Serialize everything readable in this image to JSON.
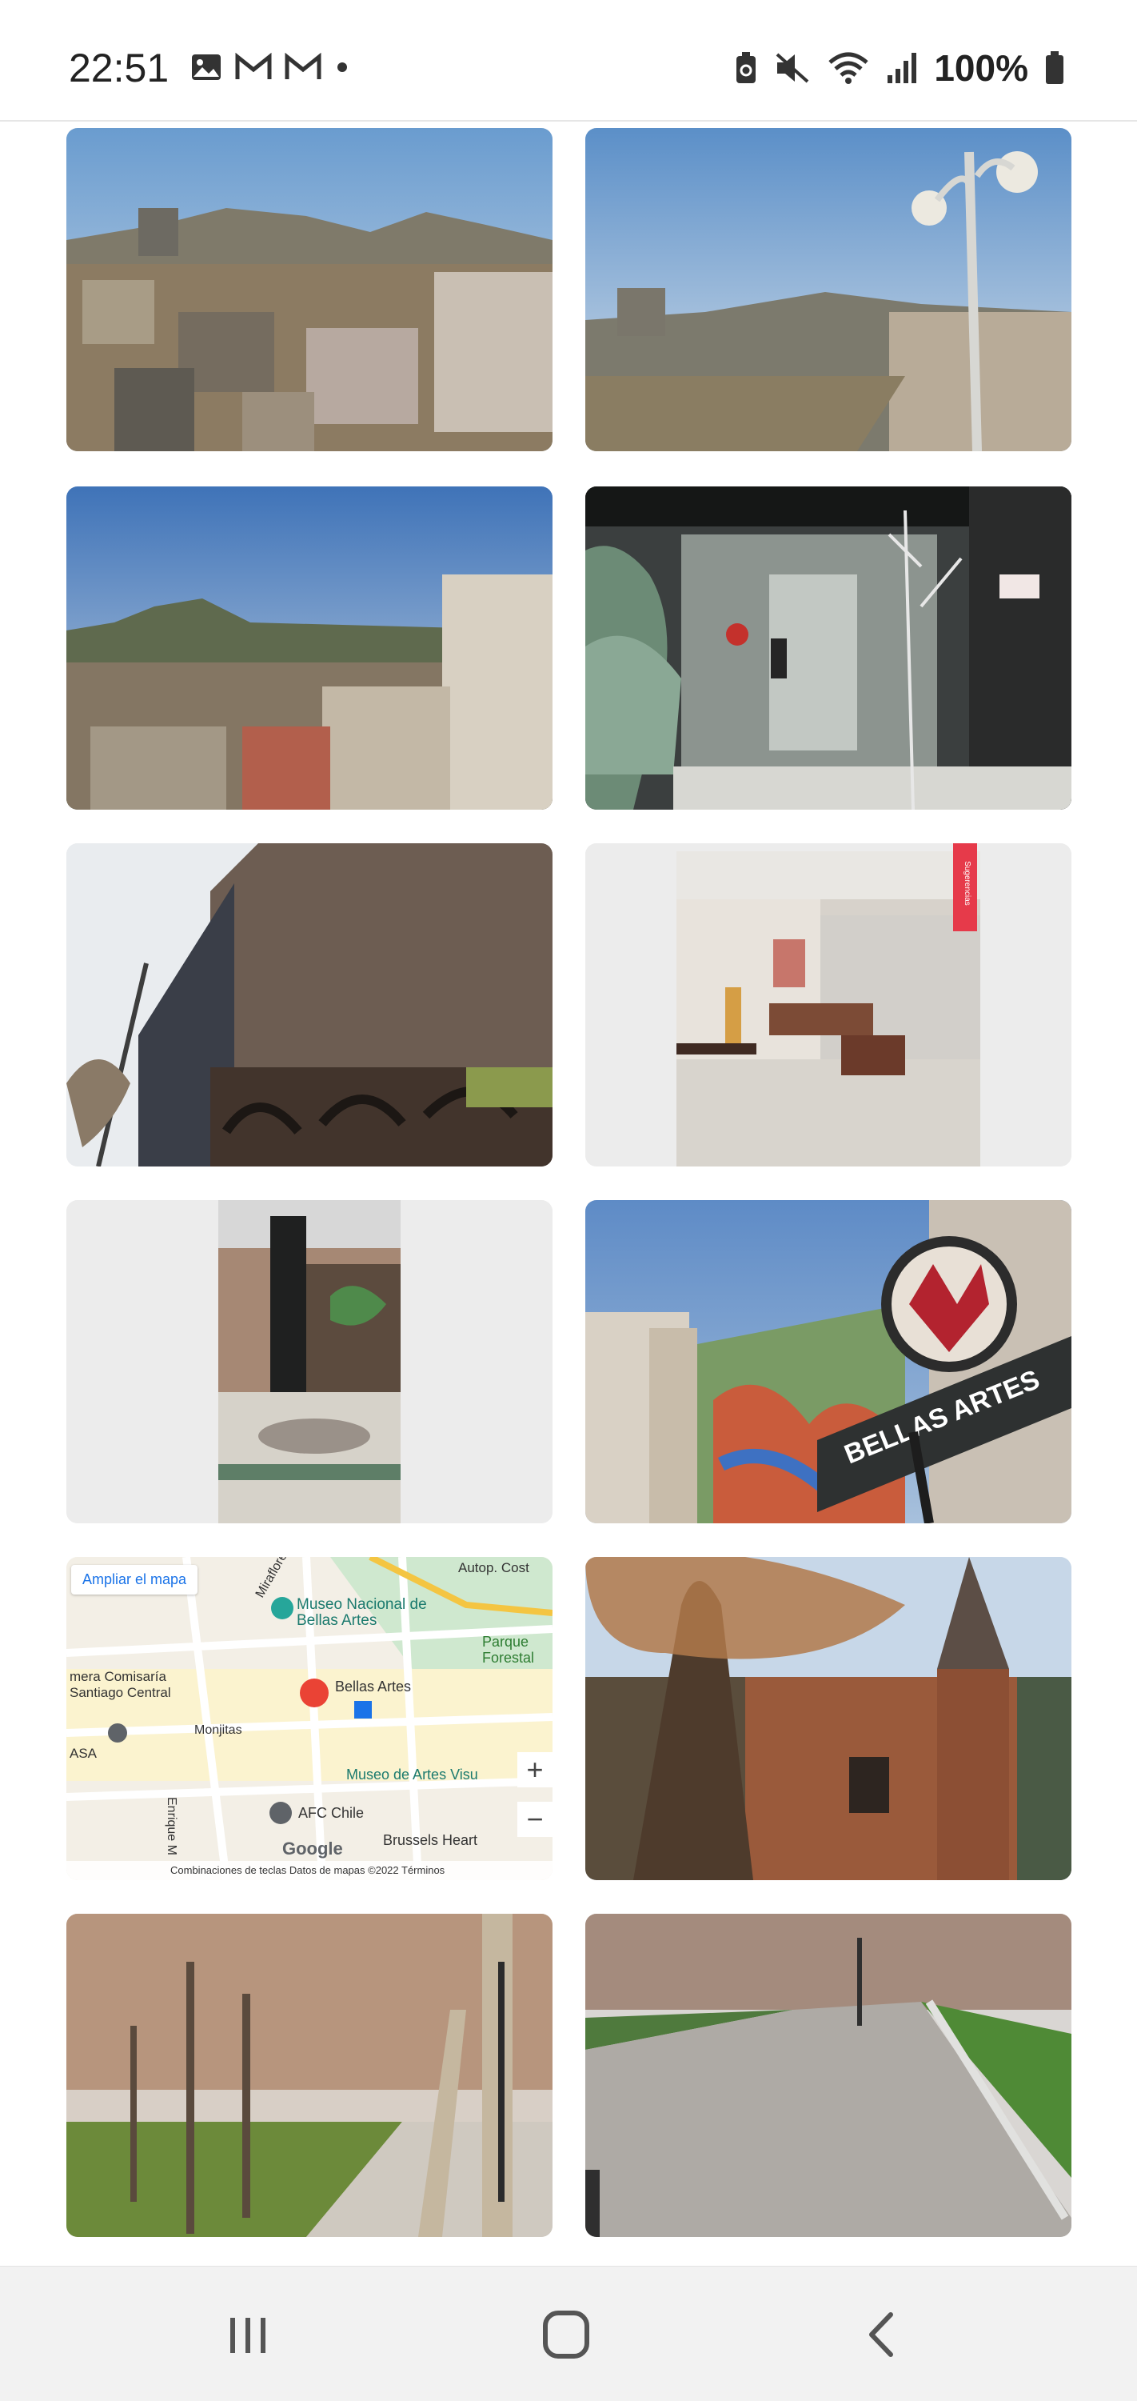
{
  "status_bar": {
    "time": "22:51",
    "battery": "100%",
    "left_icons": [
      "gallery-icon",
      "gmail-icon",
      "gmail-icon",
      "dot-icon"
    ],
    "right_icons": [
      "battery-saver-icon",
      "mute-icon",
      "wifi-icon",
      "signal-icon",
      "battery-icon"
    ]
  },
  "photos": [
    {
      "name": "photo-city-panorama"
    },
    {
      "name": "photo-rooftop-lamp"
    },
    {
      "name": "photo-city-hill-view"
    },
    {
      "name": "photo-building-entrance"
    },
    {
      "name": "photo-tall-building-street"
    },
    {
      "name": "photo-lobby-interior"
    },
    {
      "name": "photo-courtyard-fountain"
    },
    {
      "name": "photo-bellas-artes-sign",
      "sign_text": "BELLAS ARTES"
    },
    {
      "name": "map-thumbnail"
    },
    {
      "name": "photo-castle-building"
    },
    {
      "name": "photo-park-trees"
    },
    {
      "name": "photo-park-path"
    }
  ],
  "lobby_badge": "Sugerencias",
  "map": {
    "expand_label": "Ampliar el mapa",
    "labels": {
      "museo_nacional": "Museo Nacional de Bellas Artes",
      "parque_forestal": "Parque Forestal",
      "bellas_artes": "Bellas Artes",
      "comisaria": "mera Comisaría Santiago Central",
      "monjitas": "Monjitas",
      "museo_artes_visuales": "Museo de Artes Visu",
      "afc": "AFC Chile",
      "brussels": "Brussels Heart",
      "miraflores": "Miraflore",
      "autopista": "Autop. Cost",
      "enrique": "Enrique M",
      "asa": "ASA"
    },
    "zoom_in": "+",
    "zoom_out": "−",
    "google": "Google",
    "footer": "Combinaciones de teclas   Datos de mapas ©2022   Términos"
  },
  "nav": {
    "recent": "recent-apps-icon",
    "home": "home-icon",
    "back": "back-icon"
  }
}
